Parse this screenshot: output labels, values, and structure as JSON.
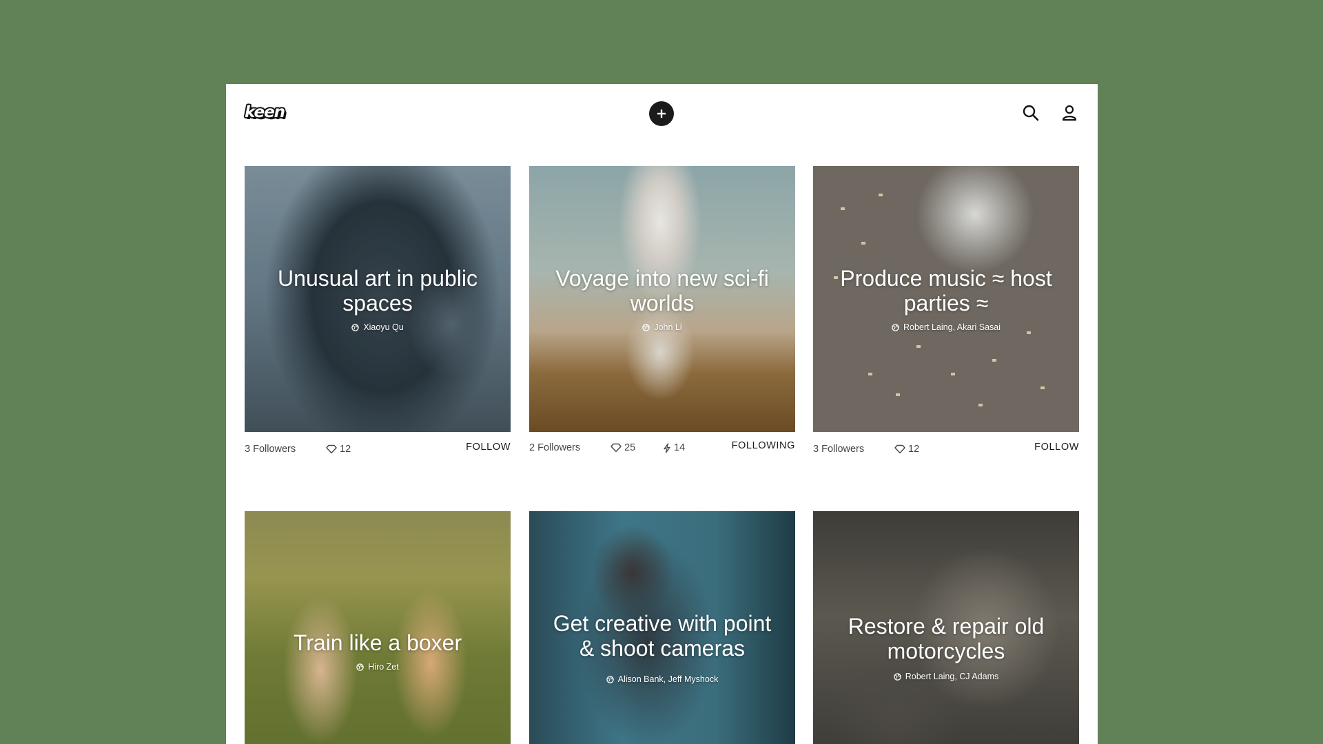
{
  "app": {
    "logo_text": "keen"
  },
  "colors": {
    "background": "#618257",
    "surface": "#ffffff",
    "text": "#1a1a1a",
    "muted_text": "#444444"
  },
  "header": {
    "add_icon": "plus-icon",
    "search_icon": "search-icon",
    "profile_icon": "user-icon"
  },
  "cards": [
    {
      "title": "Unusual art in public spaces",
      "authors": "Xiaoyu Qu",
      "followers": "3 Followers",
      "likes": "12",
      "follow_label": "FOLLOW"
    },
    {
      "title": "Voyage into new sci-fi worlds",
      "authors": "John Li",
      "followers": "2 Followers",
      "likes": "25",
      "bolts": "14",
      "follow_label": "FOLLOWING"
    },
    {
      "title": "Produce music ≈ host parties ≈",
      "authors": "Robert Laing, Akari Sasai",
      "followers": "3 Followers",
      "likes": "12",
      "follow_label": "FOLLOW"
    },
    {
      "title": "Train like a boxer",
      "authors": "Hiro Zet"
    },
    {
      "title": "Get creative with point & shoot cameras",
      "authors": "Alison Bank, Jeff Myshock"
    },
    {
      "title": "Restore & repair old motorcycles",
      "authors": "Robert Laing, CJ Adams"
    }
  ]
}
